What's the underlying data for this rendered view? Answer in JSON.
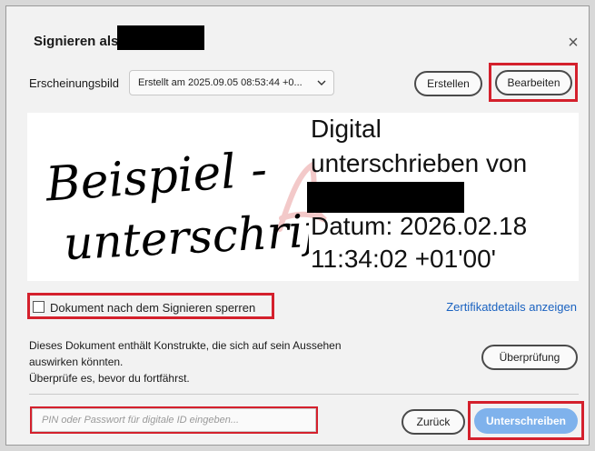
{
  "dialog": {
    "title": "Signieren als",
    "close_glyph": "×"
  },
  "appearance": {
    "label": "Erscheinungsbild",
    "selected": "Erstellt am 2025.09.05 08:53:44 +0...",
    "create_label": "Erstellen",
    "edit_label": "Bearbeiten"
  },
  "signature": {
    "handwriting_line1": "Beispiel -",
    "handwriting_line2": "unterschrift",
    "lines": [
      "Digital",
      "unterschrieben von",
      "Datum: 2026.02.18",
      "11:34:02 +01'00'"
    ]
  },
  "options": {
    "lock_label": "Dokument nach dem Signieren sperren",
    "lock_checked": false,
    "cert_link": "Zertifikatdetails anzeigen"
  },
  "notice": {
    "line1": "Dieses Dokument enthält Konstrukte, die sich auf sein Aussehen",
    "line2": "auswirken könnten.",
    "line3": "Überprüfe es, bevor du fortfährst.",
    "review_label": "Überprüfung"
  },
  "footer": {
    "pin_placeholder": "PIN oder Passwort für digitale ID eingeben...",
    "back_label": "Zurück",
    "sign_label": "Unterschreiben"
  },
  "colors": {
    "highlight": "#d4202c",
    "primary": "#7fb2ec",
    "link": "#1a62c0"
  },
  "icons": {
    "close": "close-icon",
    "dropdown": "chevron-down-icon",
    "checkbox": "checkbox-icon"
  }
}
